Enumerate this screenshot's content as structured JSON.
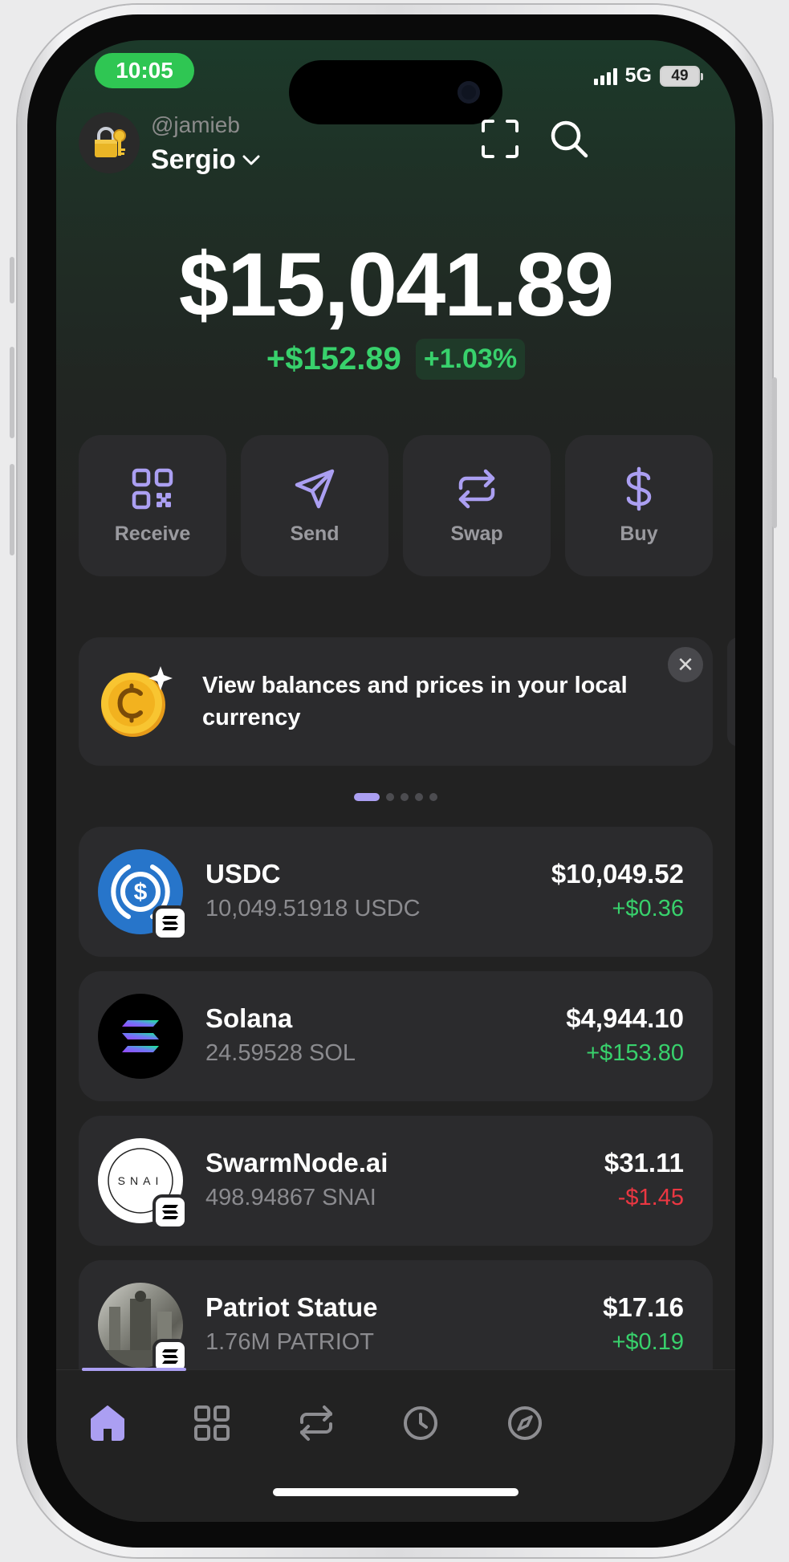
{
  "status_bar": {
    "time": "10:05",
    "network": "5G",
    "battery": "49"
  },
  "header": {
    "handle": "@jamieb",
    "account_name": "Sergio",
    "avatar_icon": "lock-key-icon",
    "scan_icon": "scan-icon",
    "search_icon": "search-icon"
  },
  "portfolio": {
    "balance": "$15,041.89",
    "change_abs": "+$152.89",
    "change_pct": "+1.03%",
    "positive_color": "#38d16c"
  },
  "actions": [
    {
      "label": "Receive",
      "icon": "qr-code-icon"
    },
    {
      "label": "Send",
      "icon": "send-icon"
    },
    {
      "label": "Swap",
      "icon": "swap-icon"
    },
    {
      "label": "Buy",
      "icon": "dollar-icon"
    }
  ],
  "promo": {
    "text": "View balances and prices in your local currency",
    "close_icon": "close-icon",
    "total_pages": 5,
    "active_page": 1
  },
  "tokens": [
    {
      "name": "USDC",
      "amount": "10,049.51918 USDC",
      "value": "$10,049.52",
      "change": "+$0.36",
      "direction": "up"
    },
    {
      "name": "Solana",
      "amount": "24.59528 SOL",
      "value": "$4,944.10",
      "change": "+$153.80",
      "direction": "up"
    },
    {
      "name": "SwarmNode.ai",
      "amount": "498.94867 SNAI",
      "value": "$31.11",
      "change": "-$1.45",
      "direction": "down",
      "logo_text": "SNAI"
    },
    {
      "name": "Patriot Statue",
      "amount": "1.76M PATRIOT",
      "value": "$17.16",
      "change": "+$0.19",
      "direction": "up"
    }
  ],
  "bottom_nav": [
    {
      "icon": "home-icon",
      "active": true
    },
    {
      "icon": "grid-icon",
      "active": false
    },
    {
      "icon": "swap-arrows-icon",
      "active": false
    },
    {
      "icon": "history-clock-icon",
      "active": false
    },
    {
      "icon": "compass-icon",
      "active": false
    }
  ],
  "colors": {
    "accent": "#ab9ff2",
    "positive": "#38d16c",
    "negative": "#eb3742",
    "card": "#2b2b2d"
  }
}
